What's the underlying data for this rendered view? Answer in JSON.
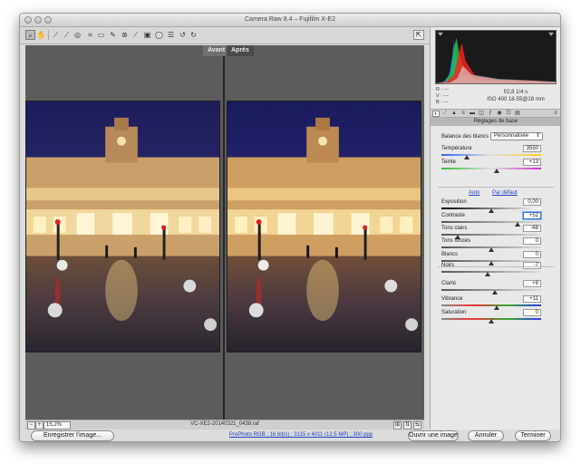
{
  "window": {
    "title": "Camera Raw 8.4  –  Fujifilm X-E2"
  },
  "toolbar": {
    "tools": [
      "zoom",
      "hand",
      "white-balance",
      "color-sampler",
      "targeted-adjustment",
      "crop",
      "straighten",
      "spot-removal",
      "red-eye",
      "adjustment-brush",
      "graduated-filter",
      "radial-filter",
      "preferences",
      "rotate-left",
      "rotate-right"
    ]
  },
  "preview": {
    "before_label": "Avant",
    "after_label": "Après",
    "zoom": "15,2%",
    "filename": "VC-XE2-20140321_0438.raf"
  },
  "histogram": {
    "r": "R :   ---",
    "g": "V :   ---",
    "b": "B :   ---",
    "aperture_shutter": "f/2,8   1/4 s",
    "iso_lens": "ISO 400   18-55@18 mm"
  },
  "panel": {
    "title": "Réglages de base",
    "wb_label": "Balance des blancs :",
    "wb_value": "Personnalisée",
    "auto_link": "Auto",
    "default_link": "Par défaut",
    "sliders": [
      {
        "label": "Température",
        "value": "3550",
        "pos": 0.25
      },
      {
        "label": "Teinte",
        "value": "+13",
        "pos": 0.55
      },
      {
        "label": "Exposition",
        "value": "0,00",
        "pos": 0.5
      },
      {
        "label": "Contraste",
        "value": "+52",
        "pos": 0.76
      },
      {
        "label": "Tons clairs",
        "value": "-68",
        "pos": 0.16
      },
      {
        "label": "Tons foncés",
        "value": "0",
        "pos": 0.5
      },
      {
        "label": "Blancs",
        "value": "0",
        "pos": 0.5
      },
      {
        "label": "Noirs",
        "value": "-7",
        "pos": 0.465
      },
      {
        "label": "Clarté",
        "value": "+8",
        "pos": 0.54
      },
      {
        "label": "Vibrance",
        "value": "+11",
        "pos": 0.555
      },
      {
        "label": "Saturation",
        "value": "0",
        "pos": 0.5
      }
    ]
  },
  "bottom": {
    "save_label": "Enregistrer l'image...",
    "workflow_link": "ProPhoto RGB ; 16 bit(s) ; 3115 x 4011 (12,5 MP) ; 300 ppp",
    "open_label": "Ouvrir une image",
    "cancel_label": "Annuler",
    "done_label": "Terminer"
  }
}
